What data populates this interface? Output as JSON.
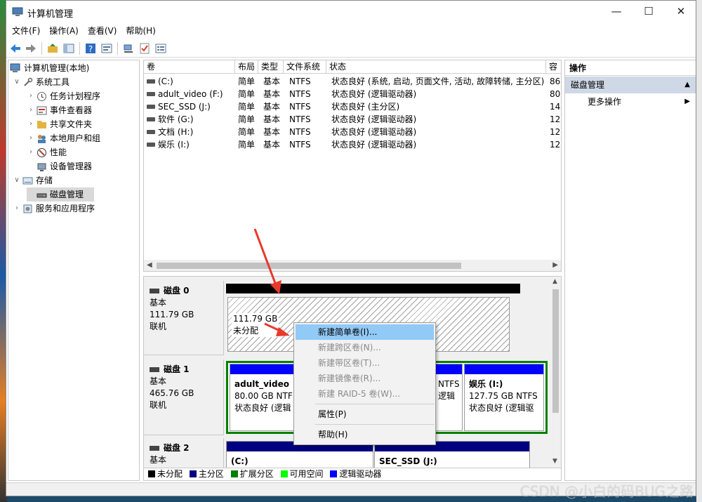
{
  "window": {
    "title": "计算机管理"
  },
  "menu": [
    "文件(F)",
    "操作(A)",
    "查看(V)",
    "帮助(H)"
  ],
  "tree": [
    {
      "label": "计算机管理(本地)",
      "icon": "computer-icon"
    },
    {
      "label": "系统工具",
      "icon": "tools-icon"
    },
    {
      "label": "任务计划程序",
      "icon": "clock-icon"
    },
    {
      "label": "事件查看器",
      "icon": "event-viewer-icon"
    },
    {
      "label": "共享文件夹",
      "icon": "shared-folder-icon"
    },
    {
      "label": "本地用户和组",
      "icon": "users-icon"
    },
    {
      "label": "性能",
      "icon": "performance-icon"
    },
    {
      "label": "设备管理器",
      "icon": "device-manager-icon"
    },
    {
      "label": "存储",
      "icon": "storage-icon"
    },
    {
      "label": "磁盘管理",
      "icon": "disk-icon"
    },
    {
      "label": "服务和应用程序",
      "icon": "services-icon"
    }
  ],
  "volume_list": {
    "headers": [
      "卷",
      "布局",
      "类型",
      "文件系统",
      "状态",
      "容"
    ],
    "rows": [
      [
        "(C:)",
        "简单",
        "基本",
        "NTFS",
        "状态良好 (系统, 启动, 页面文件, 活动, 故障转储, 主分区)",
        "86"
      ],
      [
        "adult_video (F:)",
        "简单",
        "基本",
        "NTFS",
        "状态良好 (逻辑驱动器)",
        "80"
      ],
      [
        "SEC_SSD (J:)",
        "简单",
        "基本",
        "NTFS",
        "状态良好 (主分区)",
        "14"
      ],
      [
        "软件 (G:)",
        "简单",
        "基本",
        "NTFS",
        "状态良好 (逻辑驱动器)",
        "12"
      ],
      [
        "文档 (H:)",
        "简单",
        "基本",
        "NTFS",
        "状态良好 (逻辑驱动器)",
        "12"
      ],
      [
        "娱乐 (I:)",
        "简单",
        "基本",
        "NTFS",
        "状态良好 (逻辑驱动器)",
        "12"
      ]
    ]
  },
  "disks": [
    {
      "name": "磁盘 0",
      "type": "基本",
      "size": "111.79 GB",
      "status": "联机",
      "partition": {
        "size": "111.79 GB",
        "state": "未分配"
      }
    },
    {
      "name": "磁盘 1",
      "type": "基本",
      "size": "465.76 GB",
      "status": "联机",
      "partitions": [
        {
          "name": "adult_video",
          "detail": "80.00 GB NTF",
          "state": "状态良好 (逻辑"
        },
        {
          "name": "",
          "detail": "NTFS",
          "state": "逻辑"
        },
        {
          "name": "娱乐  (I:)",
          "detail": "127.75 GB NTFS",
          "state": "状态良好 (逻辑驱"
        }
      ]
    },
    {
      "name": "磁盘 2",
      "type": "基本",
      "partitions": [
        {
          "name": "(C:)"
        },
        {
          "name": "SEC_SSD   (J:)"
        }
      ]
    }
  ],
  "legend": [
    {
      "label": "未分配",
      "color": "#000000"
    },
    {
      "label": "主分区",
      "color": "#000080"
    },
    {
      "label": "扩展分区",
      "color": "#008000"
    },
    {
      "label": "可用空间",
      "color": "#00ff00"
    },
    {
      "label": "逻辑驱动器",
      "color": "#0000ff"
    }
  ],
  "actions": {
    "header": "操作",
    "selected": "磁盘管理",
    "more": "更多操作"
  },
  "context_menu": {
    "items": [
      {
        "label": "新建简单卷(I)...",
        "state": "highlighted"
      },
      {
        "label": "新建跨区卷(N)...",
        "state": "disabled"
      },
      {
        "label": "新建带区卷(T)...",
        "state": "disabled"
      },
      {
        "label": "新建镜像卷(R)...",
        "state": "disabled"
      },
      {
        "label": "新建 RAID-5 卷(W)...",
        "state": "disabled"
      },
      {
        "label": "属性(P)",
        "state": "enabled"
      },
      {
        "label": "帮助(H)",
        "state": "enabled"
      }
    ]
  },
  "watermark": "CSDN @小白的码BUG之路",
  "colors": {
    "primary_partition": "#000080",
    "logical_drive": "#0000ff",
    "extended": "#008000",
    "unallocated": "#000000",
    "menu_highlight": "#91c9f7",
    "arrow": "#e8392b"
  }
}
